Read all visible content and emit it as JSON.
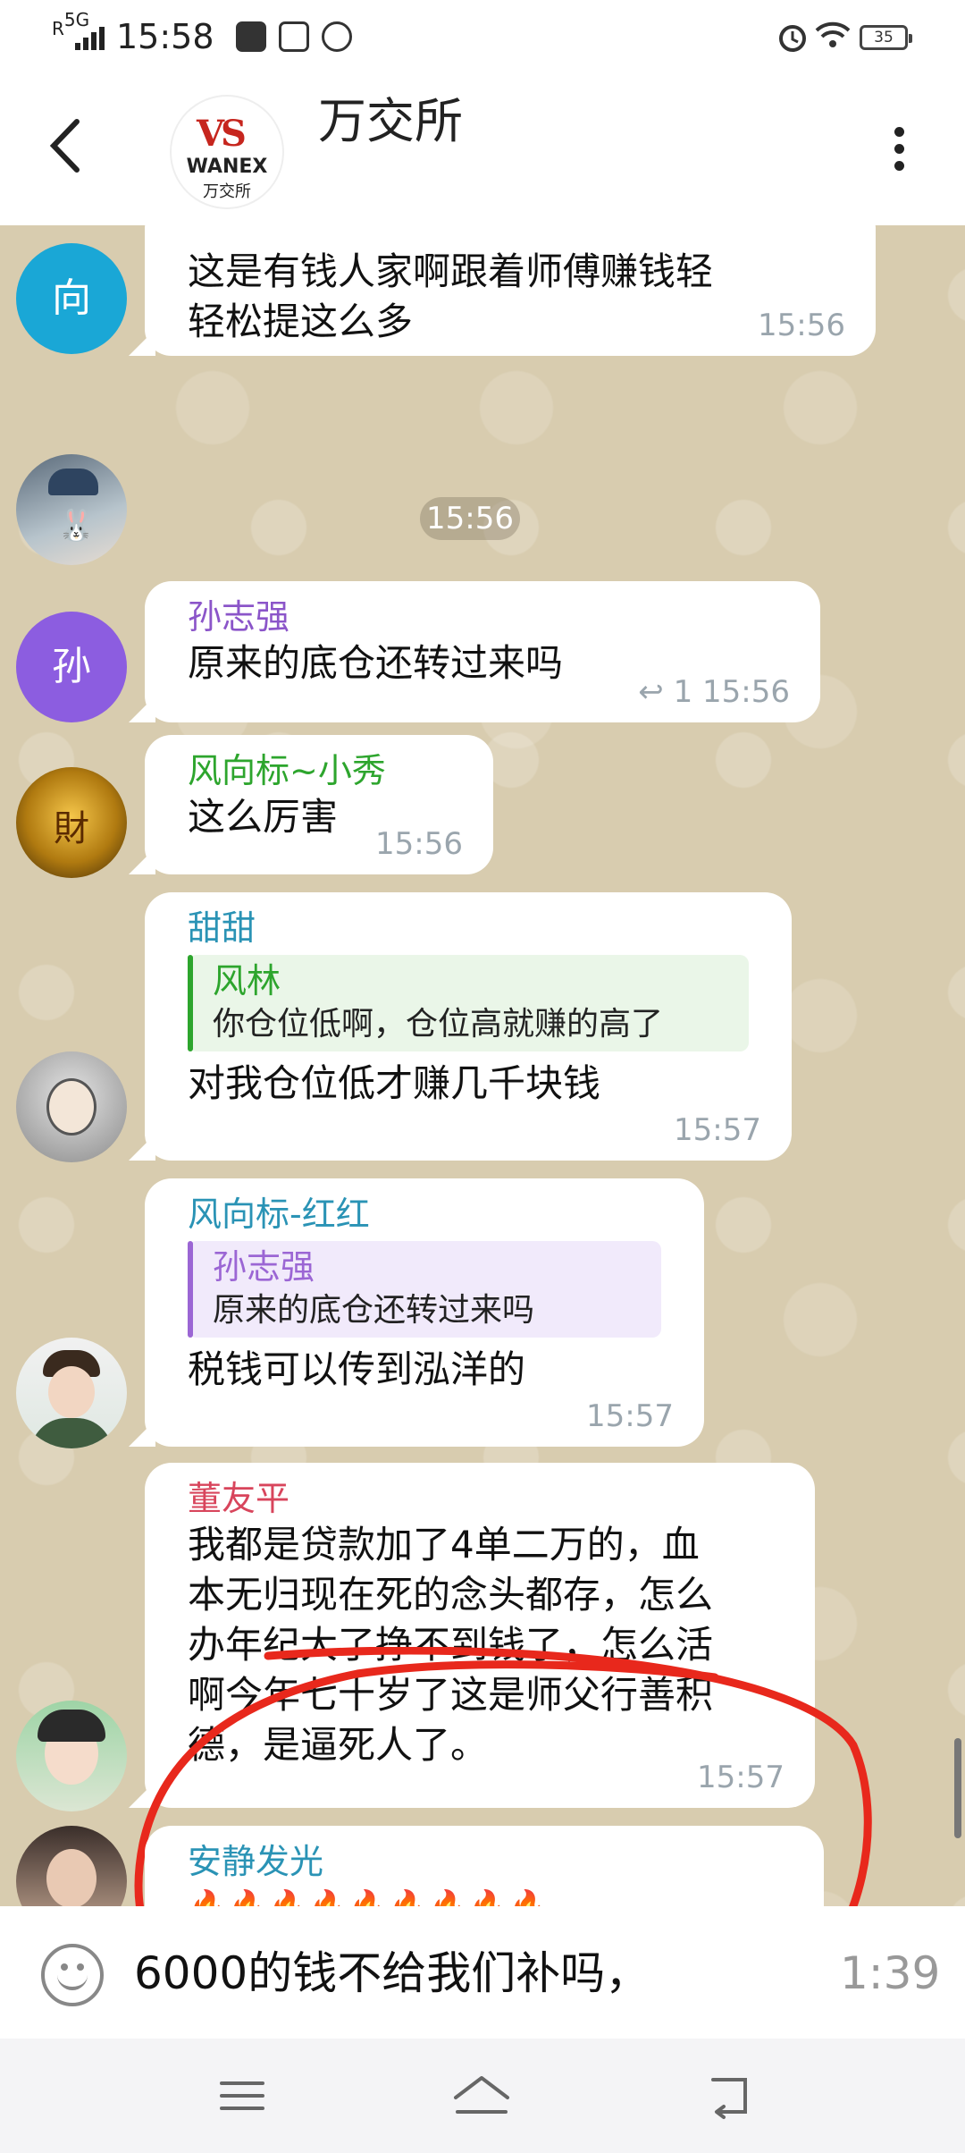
{
  "status_bar": {
    "network": "5G",
    "roaming": "R",
    "time": "15:58",
    "battery": "35"
  },
  "header": {
    "title": "万交所",
    "logo": {
      "mark": "VS",
      "brand": "WANEX",
      "brand_cn": "万交所"
    }
  },
  "messages": [
    {
      "avatar_letter": "向",
      "avatar_color": "#1aa7d6",
      "text": "这是有钱人家啊跟着师傅赚钱轻轻松提这么多",
      "lines": [
        "这是有钱人家啊跟着师傅赚钱轻",
        "轻松提这么多"
      ],
      "time": "15:56"
    },
    {
      "emoji": "👍👍👍",
      "time": "15:56"
    },
    {
      "avatar_letter": "孙",
      "avatar_color": "#8c5de0",
      "sender": "孙志强",
      "sender_color": "#8b55c9",
      "text": "原来的底仓还转过来吗",
      "reply_count": "1",
      "time": "15:56"
    },
    {
      "sender": "风向标~小秀",
      "sender_color": "#2da52d",
      "text": "这么厉害",
      "time": "15:56"
    },
    {
      "sender": "甜甜",
      "sender_color": "#2a93b5",
      "quote": {
        "name": "风林",
        "text": "你仓位低啊，仓位高就赚的高了",
        "color": "#2da52d",
        "bg": "#eaf6e8"
      },
      "text": "对我仓位低才赚几千块钱",
      "time": "15:57"
    },
    {
      "sender": "风向标-红红",
      "sender_color": "#2a93b5",
      "quote": {
        "name": "孙志强",
        "text": "原来的底仓还转过来吗",
        "color": "#9b66d4",
        "bg": "#f1eafb"
      },
      "text": "税钱可以传到泓洋的",
      "time": "15:57"
    },
    {
      "sender": "董友平",
      "sender_color": "#d8455c",
      "text": "我都是贷款加了4单二万的，血本无归现在死的念头都存，怎么办年纪大了挣不到钱了，怎么活啊今年七十岁了这是师父行善积德，是逼死人了。",
      "lines": [
        "我都是贷款加了4单二万的，血",
        "本无归现在死的念头都存，怎么",
        "办年纪大了挣不到钱了，怎么活",
        "啊今年七十岁了这是师父行善积",
        "德，是逼死人了。"
      ],
      "time": "15:57"
    },
    {
      "sender": "安静发光",
      "sender_color": "#2a93b5",
      "emoji": "🔥🔥🔥🔥🔥🔥🔥🔥🔥"
    }
  ],
  "input": {
    "text": "6000的钱不给我们补吗，",
    "recording_time": "1:39"
  }
}
